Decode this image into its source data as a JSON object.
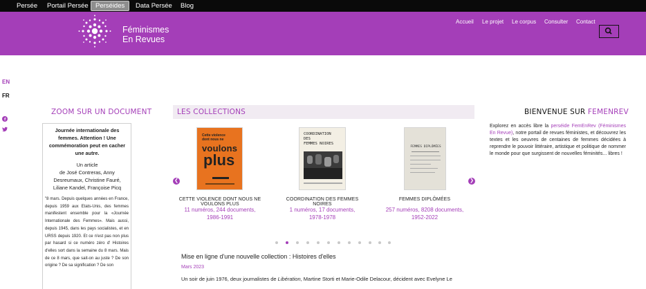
{
  "topbar": {
    "tabs": [
      {
        "label": "Persée"
      },
      {
        "label": "Portail Persée"
      },
      {
        "label": "Perséides"
      },
      {
        "label": "Data Persée"
      },
      {
        "label": "Blog"
      }
    ]
  },
  "header": {
    "brand_line1": "Féminismes",
    "brand_line2": "En Revues",
    "nav": [
      {
        "label": "Accueil"
      },
      {
        "label": "Le projet"
      },
      {
        "label": "Le corpus"
      },
      {
        "label": "Consulter"
      },
      {
        "label": "Contact"
      }
    ]
  },
  "lang": {
    "en": "EN",
    "fr": "FR"
  },
  "zoom": {
    "title": "ZOOM SUR UN DOCUMENT",
    "doc_title": "Journée internationale des femmes. Attention ! Une commémoration peut en cacher une autre.",
    "type_label": "Un article",
    "authors_prefix": "de José Contreras, Anny Desreumaux, Christine Fauré, Liliane Kandel, Françoise Picq",
    "excerpt": "\"8 mars. Depuis quelques années en France, depuis 1959 aux Etats-Unis, des femmes manifestent ensemble pour la «Journée Internationale des Femmes». Mais aussi, depuis 1945, dans les pays socialistes, et en URSS depuis 1920. Et ce n'est pas non plus par hasard si ce numéro zéro d' Histoires d'elles sort dans la semaine du 8 mars. Mais de ce 8 mars, que sait-on au juste ? De son origine ? De sa signification ? De son"
  },
  "collections": {
    "title": "LES COLLECTIONS",
    "items": [
      {
        "name": "CETTE VIOLENCE DONT NOUS NE VOULONS PLUS",
        "stats": "11 numéros, 244 documents,",
        "years": "1986-1991",
        "cover_color": "#e8731f",
        "cover_lines": [
          "Cette violence",
          "dont nous ne",
          "voulons",
          "plus"
        ]
      },
      {
        "name": "COORDINATION DES FEMMES NOIRES",
        "stats": "1 numéros, 17 documents,",
        "years": "1978-1978",
        "cover_color": "#f3efe4",
        "cover_lines": [
          "COORDINATION",
          "DES",
          "FEMMES NOIRES"
        ]
      },
      {
        "name": "FEMMES DIPLÔMÉES",
        "stats": "257 numéros, 8208 documents,",
        "years": "1952-2022",
        "cover_color": "#e4e1d8",
        "cover_lines": [
          "FEMMES DIPLÔMÉES"
        ]
      }
    ],
    "dots_total": 12,
    "dots_active": 1
  },
  "welcome": {
    "title_prefix": "BIENVENUE SUR ",
    "title_brand": "FEMENREV",
    "text_pre": "Explorez en accès libre la ",
    "text_link": "perséide FemEnRev (Féminismes En Revue)",
    "text_post": ", notre portail de revues féministes, et découvrez les textes et les oeuvres de centaines de femmes décidées à reprendre le pouvoir littéraire, artistique et politique de nommer le monde pour que surgissent de nouvelles féminités... libres !"
  },
  "news": {
    "title": "Mise en ligne d'une nouvelle collection : Histoires d'elles",
    "date": "Mars 2023",
    "body_pre": "Un soir de juin 1976, deux journalistes de ",
    "body_italic": "Libération",
    "body_post": ", Martine Storti et Marie-Odile Delacour, décident avec Evelyne Le"
  },
  "colors": {
    "brand": "#a43eb8",
    "topbar": "#0a0a0a",
    "collections_band": "#f1ebf2"
  }
}
